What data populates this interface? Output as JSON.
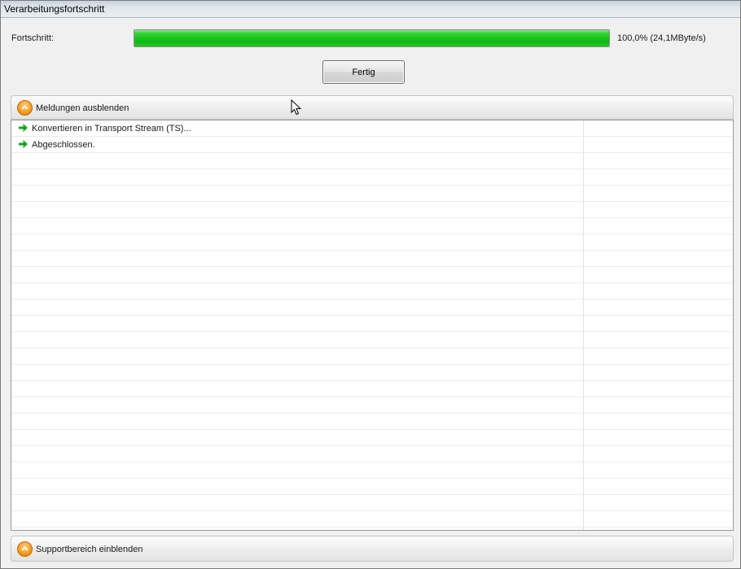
{
  "window": {
    "title": "Verarbeitungsfortschritt"
  },
  "progress": {
    "label": "Fortschritt:",
    "fraction": 1.0,
    "value_text": "100,0% (24,1MByte/s)",
    "fill_color": "#1ec41e"
  },
  "finish_button": {
    "label": "Fertig"
  },
  "messages_section": {
    "toggle_label": "Meldungen ausblenden",
    "items": [
      {
        "text": "Konvertieren in Transport Stream (TS)...",
        "icon": "green-arrow-right-icon"
      },
      {
        "text": "Abgeschlossen.",
        "icon": "green-arrow-right-icon"
      }
    ]
  },
  "support_section": {
    "toggle_label": "Supportbereich einblenden"
  },
  "colors": {
    "accent_orange": "#f39a1d",
    "arrow_green": "#1aa31a"
  }
}
